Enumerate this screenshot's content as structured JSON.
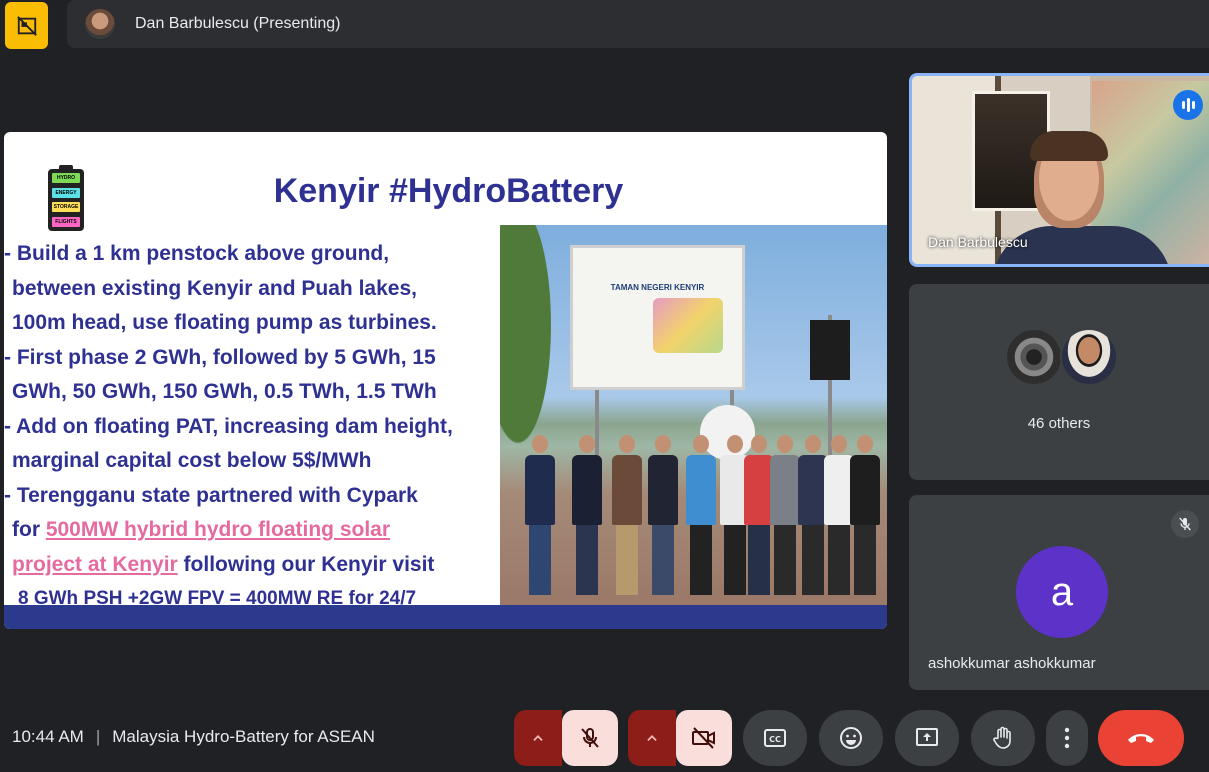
{
  "topbar": {
    "presenter_label": "Dan Barbulescu (Presenting)",
    "layout_icon": "layout-off-icon"
  },
  "slide": {
    "title": "Kenyir #HydroBattery",
    "battery_labels": [
      "HYDRO",
      "ENERGY",
      "STORAGE",
      "FLIGHTS"
    ],
    "bullets": [
      "- Build a 1 km penstock above ground,",
      "between existing Kenyir and Puah lakes,",
      "100m head, use floating pump as turbines.",
      "- First phase 2 GWh, followed by 5 GWh, 15",
      "GWh, 50 GWh, 150 GWh, 0.5 TWh, 1.5 TWh",
      "- Add on floating PAT, increasing dam height,",
      "marginal capital cost below 5$/MWh",
      "- Terengganu state partnered with Cypark"
    ],
    "link_prefix": "for ",
    "link_text_1": "500MW hybrid hydro floating solar",
    "link_text_2": "project at Kenyir",
    "link_suffix": " following our Kenyir visit",
    "last_line": "8 GWh PSH +2GW FPV = 400MW RE for 24/7",
    "billboard_title": "TAMAN NEGERI KENYIR"
  },
  "participants": {
    "self_name": "Dan Barbulescu",
    "others_label": "46 others",
    "ashok_initial": "a",
    "ashok_name": "ashokkumar ashokkumar"
  },
  "bottombar": {
    "time": "10:44 AM",
    "separator": "|",
    "meeting_title": "Malaysia Hydro-Battery for ASEAN"
  },
  "colors": {
    "slide_title": "#2e3192",
    "link": "#e56aa0",
    "accent_yellow": "#fbbc04",
    "hangup_red": "#ea4335",
    "avatar_purple": "#5c32c9",
    "active_border": "#8ab4f8"
  }
}
